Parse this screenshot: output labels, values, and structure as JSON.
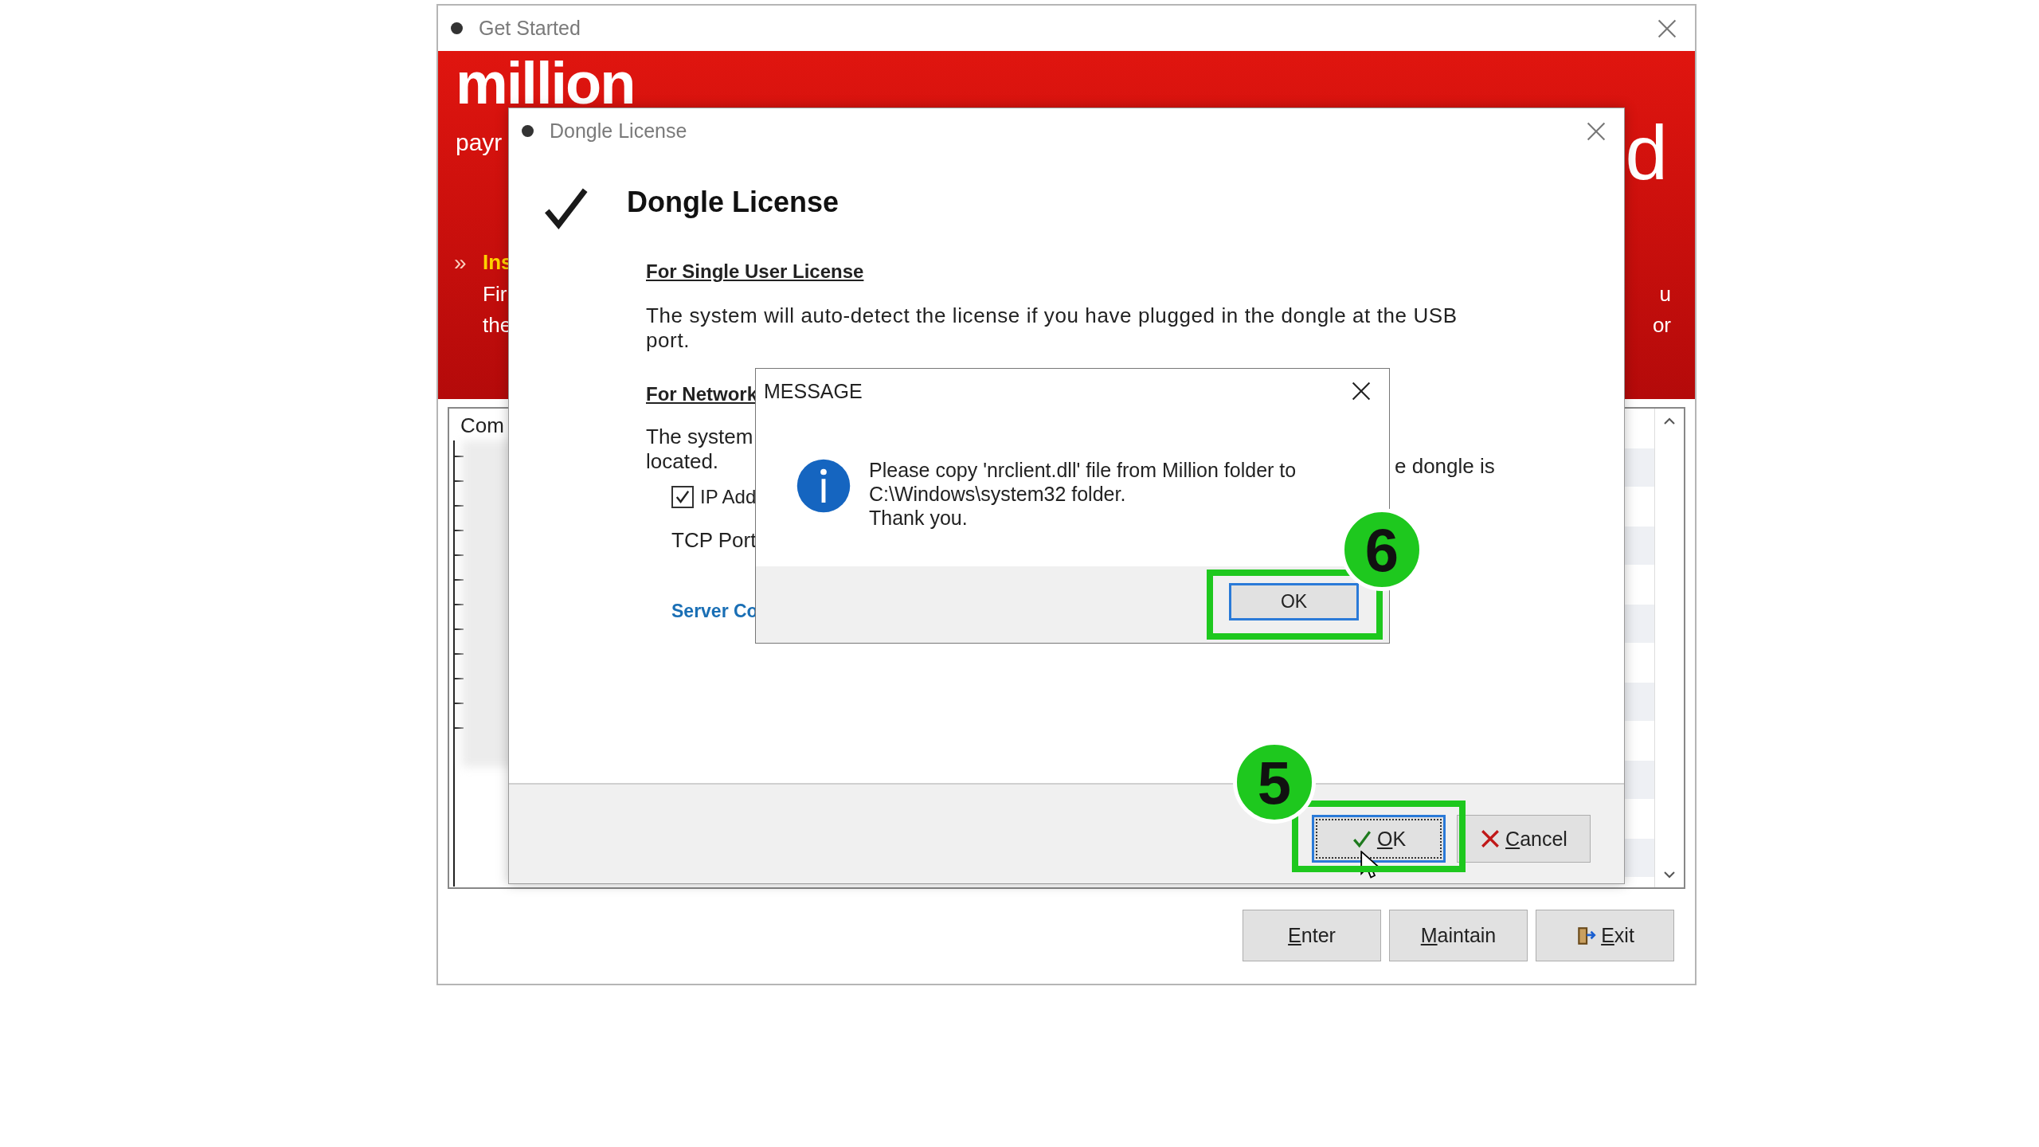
{
  "main_window": {
    "title": "Get Started",
    "banner": {
      "logo": "million",
      "tagline": "payr",
      "right_fragment": "d",
      "link_marker": "»",
      "link_label": "Ins",
      "left_lines": [
        "Fir",
        "the"
      ],
      "right_lines": [
        "u",
        "or"
      ]
    },
    "list": {
      "header": "Com"
    },
    "buttons": [
      {
        "label": "Enter",
        "kind": "plain"
      },
      {
        "label": "Maintain",
        "kind": "plain"
      },
      {
        "label": "Exit",
        "kind": "exit"
      }
    ]
  },
  "dongle_dialog": {
    "title": "Dongle License",
    "heading": "Dongle License",
    "single_user": {
      "heading": "For Single User License",
      "text": "The system will auto-detect the license if you have plugged in the dongle at the USB port."
    },
    "network": {
      "heading": "For Network",
      "text_left": "The system",
      "text_right": "e dongle is",
      "text_line_2": "located.",
      "ip_option": {
        "label": "IP Add",
        "checked": true
      },
      "tcp_port_label": "TCP Port",
      "server_link": "Server Co"
    },
    "buttons": [
      {
        "label": "OK",
        "kind": "ok",
        "focused": true
      },
      {
        "label": "Cancel",
        "kind": "cancel",
        "focused": false
      }
    ]
  },
  "message_box": {
    "title": "MESSAGE",
    "lines": [
      "Please copy 'nrclient.dll' file from Million folder to",
      "C:\\Windows\\system32 folder.",
      "Thank you."
    ],
    "button": {
      "label": "OK",
      "default": true
    }
  },
  "annotations": [
    {
      "label": "6"
    },
    {
      "label": "5"
    }
  ]
}
